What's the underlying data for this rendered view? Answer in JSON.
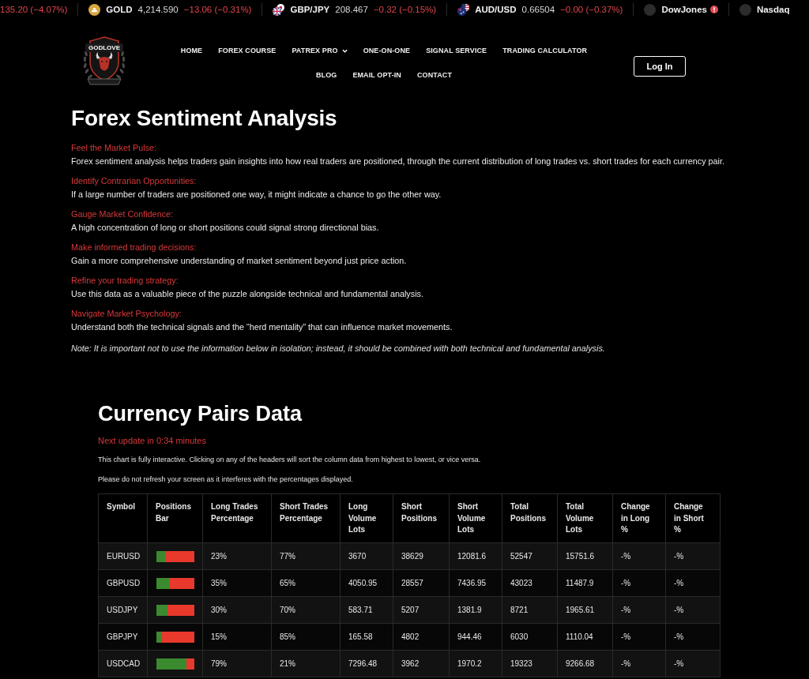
{
  "ticker": [
    {
      "kind": "partial",
      "change": "135.20 (−4.07%)"
    },
    {
      "kind": "commodity",
      "symbol": "GOLD",
      "price": "4,214.590",
      "change": "−13.06 (−0.31%)"
    },
    {
      "kind": "fx",
      "symbol": "GBP/JPY",
      "price": "208.467",
      "change": "−0.32 (−0.15%)"
    },
    {
      "kind": "fx",
      "symbol": "AUD/USD",
      "price": "0.66504",
      "change": "−0.00 (−0.37%)"
    },
    {
      "kind": "index",
      "symbol": "DowJones",
      "alert": true
    },
    {
      "kind": "index",
      "symbol": "Nasdaq",
      "alert": false
    }
  ],
  "header": {
    "logo": {
      "name": "GODLOVE"
    },
    "nav": [
      {
        "label": "HOME",
        "has_dropdown": false
      },
      {
        "label": "FOREX COURSE",
        "has_dropdown": false
      },
      {
        "label": "PATREX PRO",
        "has_dropdown": true
      },
      {
        "label": "ONE-ON-ONE",
        "has_dropdown": false
      },
      {
        "label": "SIGNAL SERVICE",
        "has_dropdown": false
      },
      {
        "label": "TRADING CALCULATOR",
        "has_dropdown": false
      },
      {
        "label": "BLOG",
        "has_dropdown": false
      },
      {
        "label": "EMAIL OPT-IN",
        "has_dropdown": false
      },
      {
        "label": "CONTACT",
        "has_dropdown": false
      }
    ],
    "login": "Log In"
  },
  "intro": {
    "title": "Forex Sentiment Analysis",
    "sections": [
      {
        "label": "Feel the Market Pulse:",
        "text": "Forex sentiment analysis helps traders gain insights into how real traders are positioned, through the current distribution of long trades vs. short trades for each currency pair."
      },
      {
        "label": "Identify Contrarian Opportunities:",
        "text": "If a large number of traders are positioned one way, it might indicate a chance to go the other way."
      },
      {
        "label": "Gauge Market Confidence:",
        "text": "A high concentration of long or short positions could signal strong directional bias."
      },
      {
        "label": "Make informed trading decisions:",
        "text": "Gain a more comprehensive understanding of market sentiment beyond just price action."
      },
      {
        "label": "Refine your trading strategy:",
        "text": "Use this data as a valuable piece of the puzzle alongside technical and fundamental analysis."
      },
      {
        "label": "Navigate Market Psychology:",
        "text": "Understand both the technical signals and the “herd mentality” that can influence market movements."
      }
    ],
    "note": "Note: It is important not to use the information below in isolation; instead, it should be combined with both technical and fundamental analysis."
  },
  "pairs": {
    "title": "Currency Pairs Data",
    "update": "Next update in 0:34 minutes",
    "info": [
      "This chart is fully interactive. Clicking on any of the headers will sort the column data from highest to lowest, or vice versa.",
      "Please do not refresh your screen as it interferes with the percentages displayed."
    ]
  },
  "table": {
    "columns": [
      "Symbol",
      "Positions Bar",
      "Long Trades Percentage",
      "Short Trades Percentage",
      "Long Volume Lots",
      "Short Positions",
      "Short Volume Lots",
      "Total Positions",
      "Total Volume Lots",
      "Change in Long %",
      "Change in Short %"
    ],
    "rows": [
      {
        "symbol": "EURUSD",
        "level": 0.23,
        "values": [
          "23%",
          "77%",
          "3670",
          "38629",
          "12081.6",
          "52547",
          "15751.6",
          "-%",
          "-%"
        ]
      },
      {
        "symbol": "GBPUSD",
        "level": 0.35,
        "values": [
          "35%",
          "65%",
          "4050.95",
          "28557",
          "7436.95",
          "43023",
          "11487.9",
          "-%",
          "-%"
        ]
      },
      {
        "symbol": "USDJPY",
        "level": 0.3,
        "values": [
          "30%",
          "70%",
          "583.71",
          "5207",
          "1381.9",
          "8721",
          "1965.61",
          "-%",
          "-%"
        ]
      },
      {
        "symbol": "GBPJPY",
        "level": 0.15,
        "values": [
          "15%",
          "85%",
          "165.58",
          "4802",
          "944.46",
          "6030",
          "1110.04",
          "-%",
          "-%"
        ]
      },
      {
        "symbol": "USDCAD",
        "level": 0.79,
        "values": [
          "79%",
          "21%",
          "7296.48",
          "3962",
          "1970.2",
          "19323",
          "9266.68",
          "-%",
          "-%"
        ]
      }
    ]
  }
}
